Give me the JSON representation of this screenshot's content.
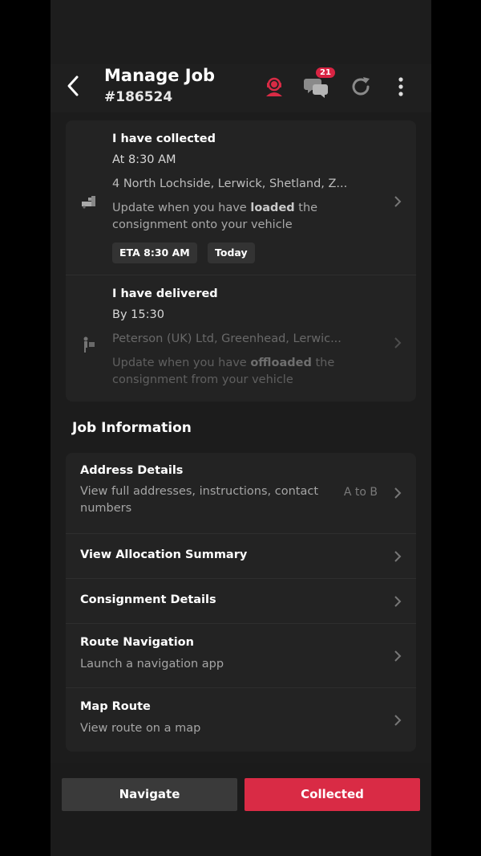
{
  "header": {
    "title": "Manage Job",
    "job_number": "#186524",
    "messages_badge": "21",
    "icons": [
      "back-arrow-icon",
      "support-agent-icon",
      "chat-bubbles-icon",
      "refresh-icon",
      "more-vertical-icon"
    ]
  },
  "steps": [
    {
      "title": "I have collected",
      "time": "At 8:30 AM",
      "address": "4 North Lochside, Lerwick, Shetland, Z...",
      "desc_pre": "Update when you have ",
      "desc_bold": "loaded",
      "desc_post": " the consignment onto your vehicle",
      "chips": [
        "ETA 8:30 AM",
        "Today"
      ],
      "icon": "loading-truck-icon"
    },
    {
      "title": "I have delivered",
      "time": "By 15:30",
      "address": "Peterson (UK) Ltd, Greenhead, Lerwic...",
      "desc_pre": "Update when you have ",
      "desc_bold": "offloaded",
      "desc_post": " the consignment from your vehicle",
      "icon": "unloading-person-icon"
    }
  ],
  "job_info": {
    "section_title": "Job Information",
    "rows": [
      {
        "title": "Address Details",
        "subtitle": "View full addresses, instructions, contact numbers",
        "meta": "A to B"
      },
      {
        "title": "View Allocation Summary"
      },
      {
        "title": "Consignment Details"
      },
      {
        "title": "Route Navigation",
        "subtitle": "Launch a navigation app"
      },
      {
        "title": "Map Route",
        "subtitle": "View route on a map"
      }
    ]
  },
  "footer": {
    "navigate_label": "Navigate",
    "collected_label": "Collected"
  },
  "colors": {
    "accent_red": "#d92b45",
    "background": "#1c1c1c",
    "card": "#232323"
  }
}
